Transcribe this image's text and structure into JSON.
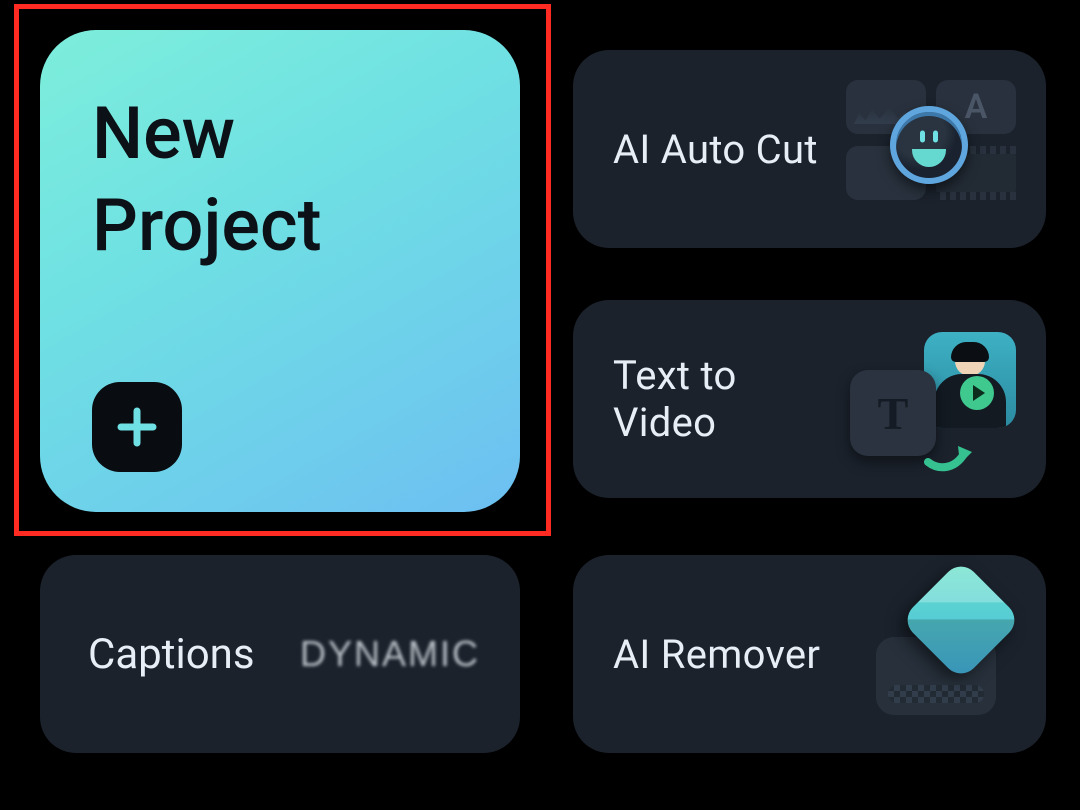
{
  "colors": {
    "background": "#000000",
    "tile": "#1b222c",
    "gradient_start": "#7deedb",
    "gradient_end": "#6dbff2",
    "highlight_border": "#ff2a22"
  },
  "hero": {
    "title": "New\nProject",
    "plus_icon": "plus-icon",
    "highlighted": true
  },
  "features": [
    {
      "id": "ai-auto-cut",
      "label": "AI Auto Cut",
      "icon": "auto-cut-icon"
    },
    {
      "id": "text-to-video",
      "label": "Text to Video",
      "icon": "text-to-video-icon",
      "badge_letter": "T"
    },
    {
      "id": "ai-remover",
      "label": "AI Remover",
      "icon": "eraser-icon"
    }
  ],
  "captions_tile": {
    "label": "Captions",
    "sample_text": "DYNAMIC"
  },
  "autocut_panel_letter": "A"
}
